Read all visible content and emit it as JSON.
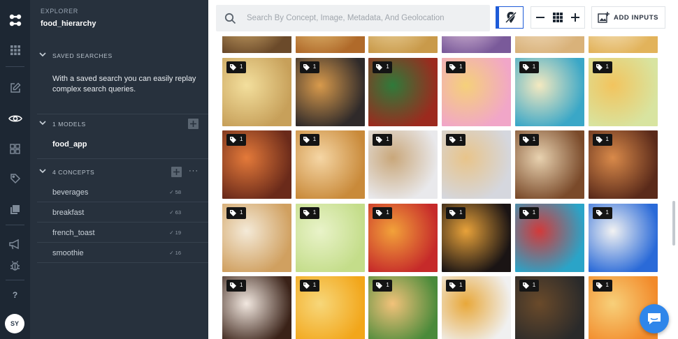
{
  "explorer": {
    "eyebrow": "EXPLORER",
    "app_name": "food_hierarchy",
    "saved_searches": {
      "label": "SAVED SEARCHES",
      "info": "With a saved search you can easily replay complex search queries."
    },
    "models": {
      "label": "1 MODELS",
      "items": [
        "food_app"
      ]
    },
    "concepts": {
      "label": "4 CONCEPTS",
      "more": "···",
      "items": [
        {
          "name": "beverages",
          "count": "✓ 58"
        },
        {
          "name": "breakfast",
          "count": "✓ 63"
        },
        {
          "name": "french_toast",
          "count": "✓ 19"
        },
        {
          "name": "smoothie",
          "count": "✓ 16"
        }
      ]
    }
  },
  "rail": {
    "avatar": "SY",
    "help": "?"
  },
  "toolbar": {
    "search_placeholder": "Search By Concept, Image, Metadata, And Geolocation",
    "add_inputs": "ADD INPUTS"
  },
  "grid": {
    "tag_count": "1",
    "tiles": [
      {
        "icon": "food-image",
        "colors": [
          "#6b4a2a",
          "#e8c07a"
        ]
      },
      {
        "icon": "food-image",
        "colors": [
          "#b06a2a",
          "#f2d58a"
        ]
      },
      {
        "icon": "food-image",
        "colors": [
          "#c99a4a",
          "#f5e3b5"
        ]
      },
      {
        "icon": "food-image",
        "colors": [
          "#7a5a9a",
          "#f4d9ea"
        ]
      },
      {
        "icon": "food-image",
        "colors": [
          "#d9b27a",
          "#f7e7cf"
        ]
      },
      {
        "icon": "food-image",
        "colors": [
          "#e2b35b",
          "#fbf1da"
        ]
      },
      {
        "icon": "food-image",
        "colors": [
          "#c7a05a",
          "#f3df9d"
        ]
      },
      {
        "icon": "food-image",
        "colors": [
          "#2f2a2a",
          "#d89a4c"
        ]
      },
      {
        "icon": "food-image",
        "colors": [
          "#9c2a1e",
          "#2f7a3a"
        ]
      },
      {
        "icon": "food-image",
        "colors": [
          "#f1a6c8",
          "#f5d07a"
        ]
      },
      {
        "icon": "food-image",
        "colors": [
          "#3aa7c7",
          "#f4e9c0"
        ]
      },
      {
        "icon": "food-image",
        "colors": [
          "#d8e4a0",
          "#f2c45e"
        ]
      },
      {
        "icon": "food-image",
        "colors": [
          "#6a2a1a",
          "#e47a3a"
        ]
      },
      {
        "icon": "food-image",
        "colors": [
          "#c98a3a",
          "#f5d6a5"
        ]
      },
      {
        "icon": "food-image",
        "colors": [
          "#e9e9ec",
          "#c9a77a"
        ]
      },
      {
        "icon": "food-image",
        "colors": [
          "#d5d7de",
          "#e8c48a"
        ]
      },
      {
        "icon": "food-image",
        "colors": [
          "#7a4a2a",
          "#e8d2b0"
        ]
      },
      {
        "icon": "food-image",
        "colors": [
          "#5a2a1a",
          "#d98a4a"
        ]
      },
      {
        "icon": "food-image",
        "colors": [
          "#d0a060",
          "#f4ead8"
        ]
      },
      {
        "icon": "food-image",
        "colors": [
          "#c4dd8a",
          "#e9f3c9"
        ]
      },
      {
        "icon": "food-image",
        "colors": [
          "#c62a2a",
          "#f2a23a"
        ]
      },
      {
        "icon": "food-image",
        "colors": [
          "#1a1414",
          "#e8a23a"
        ]
      },
      {
        "icon": "food-image",
        "colors": [
          "#2aa4c8",
          "#d23a3a"
        ]
      },
      {
        "icon": "food-image",
        "colors": [
          "#2a6ad8",
          "#f2f2f2"
        ]
      },
      {
        "icon": "food-image",
        "colors": [
          "#3a2218",
          "#f2e8e0"
        ]
      },
      {
        "icon": "food-image",
        "colors": [
          "#f2a61a",
          "#f7d77a"
        ]
      },
      {
        "icon": "food-image",
        "colors": [
          "#4a8a3a",
          "#f2c27a"
        ]
      },
      {
        "icon": "food-image",
        "colors": [
          "#f0f0f0",
          "#e8a83a"
        ]
      },
      {
        "icon": "food-image",
        "colors": [
          "#2a2a2a",
          "#6a4a2a"
        ]
      },
      {
        "icon": "food-image",
        "colors": [
          "#f28a2a",
          "#f7d07a"
        ]
      }
    ]
  }
}
